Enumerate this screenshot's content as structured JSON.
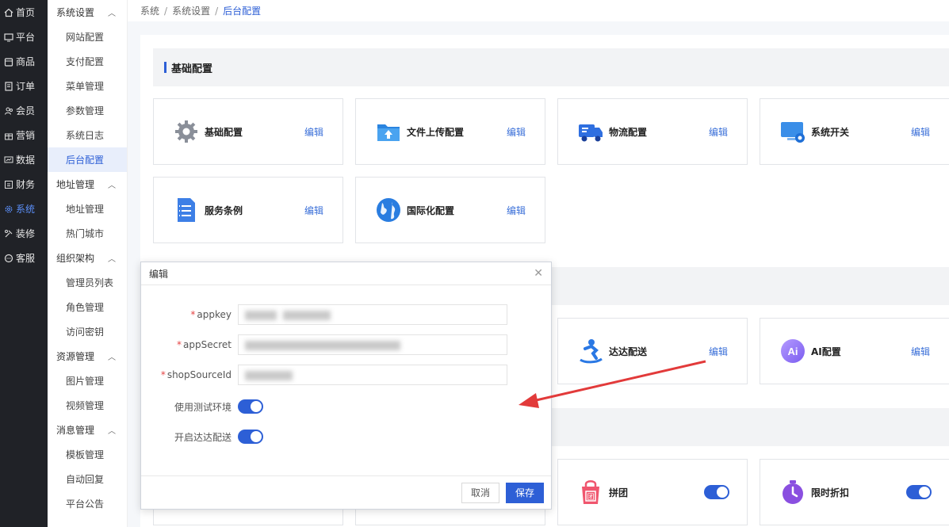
{
  "nav": [
    {
      "label": "首页",
      "icon": "home-icon"
    },
    {
      "label": "平台",
      "icon": "monitor-icon"
    },
    {
      "label": "商品",
      "icon": "box-icon"
    },
    {
      "label": "订单",
      "icon": "document-icon"
    },
    {
      "label": "会员",
      "icon": "users-icon"
    },
    {
      "label": "营销",
      "icon": "gift-icon"
    },
    {
      "label": "数据",
      "icon": "chart-icon"
    },
    {
      "label": "财务",
      "icon": "ledger-icon"
    },
    {
      "label": "系统",
      "icon": "gear-icon"
    },
    {
      "label": "装修",
      "icon": "brush-icon"
    },
    {
      "label": "客服",
      "icon": "chat-icon"
    }
  ],
  "submenu": {
    "groups": [
      {
        "title": "系统设置",
        "items": [
          "网站配置",
          "支付配置",
          "菜单管理",
          "参数管理",
          "系统日志",
          "后台配置"
        ]
      },
      {
        "title": "地址管理",
        "items": [
          "地址管理",
          "热门城市"
        ]
      },
      {
        "title": "组织架构",
        "items": [
          "管理员列表",
          "角色管理",
          "访问密钥"
        ]
      },
      {
        "title": "资源管理",
        "items": [
          "图片管理",
          "视频管理"
        ]
      },
      {
        "title": "消息管理",
        "items": [
          "模板管理",
          "自动回复",
          "平台公告"
        ]
      }
    ]
  },
  "breadcrumb": [
    "系统",
    "系统设置",
    "后台配置"
  ],
  "section": {
    "title": "基础配置"
  },
  "edit_label": "编辑",
  "cards": [
    {
      "name": "基础配置",
      "icon": "gear-icon"
    },
    {
      "name": "文件上传配置",
      "icon": "folder-upload-icon"
    },
    {
      "name": "物流配置",
      "icon": "truck-icon"
    },
    {
      "name": "系统开关",
      "icon": "monitor-switch-icon"
    },
    {
      "name": "服务条例",
      "icon": "list-document-icon"
    },
    {
      "name": "国际化配置",
      "icon": "globe-icon"
    },
    {
      "name": "达达配送",
      "icon": "courier-icon"
    },
    {
      "name": "AI配置",
      "icon": "ai-icon"
    },
    {
      "name": "拼团",
      "icon": "shopping-bag-icon"
    },
    {
      "name": "限时折扣",
      "icon": "timer-icon"
    }
  ],
  "toggles": {
    "pintuan": true,
    "flash_discount": true
  },
  "modal": {
    "title": "编辑",
    "fields": [
      {
        "label": "appkey",
        "required": true
      },
      {
        "label": "appSecret",
        "required": true
      },
      {
        "label": "shopSourceId",
        "required": true
      }
    ],
    "switches": [
      {
        "label": "使用测试环境",
        "on": true
      },
      {
        "label": "开启达达配送",
        "on": true
      }
    ],
    "cancel_label": "取消",
    "save_label": "保存"
  },
  "colors": {
    "accent": "#2d5fd6",
    "nav_bg": "#202227",
    "annotation_arrow": "#e23a3a"
  }
}
